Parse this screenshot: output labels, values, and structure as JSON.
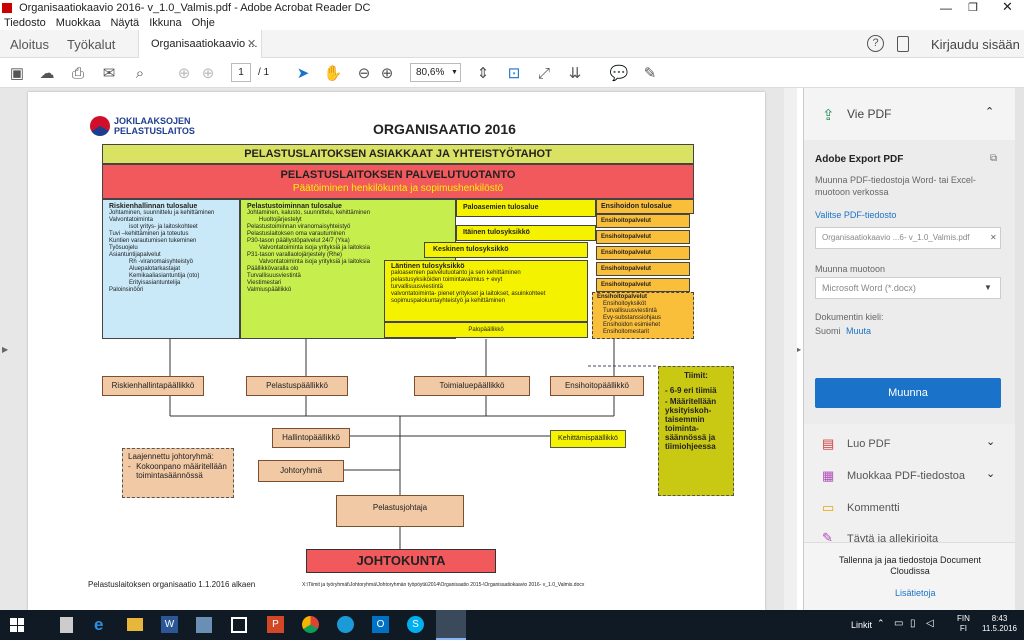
{
  "window": {
    "title": "Organisaatiokaavio 2016- v_1.0_Valmis.pdf - Adobe Acrobat Reader DC"
  },
  "menu": [
    "Tiedosto",
    "Muokkaa",
    "Näytä",
    "Ikkuna",
    "Ohje"
  ],
  "tabs": {
    "home": "Aloitus",
    "tools": "Työkalut",
    "doc": "Organisaatiokaavio ...",
    "signin": "Kirjaudu sisään"
  },
  "toolbar": {
    "page_current": "1",
    "page_total": "/ 1",
    "zoom": "80,6%"
  },
  "doc": {
    "logo_line1": "JOKILAAKSOJEN",
    "logo_line2": "PELASTUSLAITOS",
    "title": "ORGANISAATIO 2016",
    "customers": "PELASTUSLAITOKSEN ASIAKKAAT JA YHTEISTYÖTAHOT",
    "production": "PELASTUSLAITOKSEN PALVELUTUOTANTO",
    "production_sub": "Päätöiminen henkilökunta ja sopimushenkilöstö",
    "risk_title": "Riskienhallinnan tulosalue",
    "risk_items": [
      "Johtaminen, suunnittelu ja kehittäminen",
      "Valvontatoiminta",
      "isot yritys- ja laitoskohteet",
      "Tuvi –kehittäminen ja toteutus",
      "Kuntien varautumisen tukeminen",
      "Työsuojelu",
      "Asiantuntijapalvelut",
      "Rh -viranomaisyhteistyö",
      "Aluepalotarkastajat",
      "Kemikaaliasiantuntija (oto)",
      "Erityisasiantuntelija",
      "Paloinsinööri"
    ],
    "rescue_title": "Pelastustoiminnan tulosalue",
    "rescue_items": [
      "Johtaminen, kalusto, suunnittelu, kehittäminen",
      "Huoltojärjestelyt",
      "Pelastustoiminnan viranomaisyhteistyö",
      "Pelastuslaitoksen oma varautuminen",
      "P30-tason päällystöpalvelut 24/7 (Yka)",
      "Valvontatoiminta isoja yrityksiä ja laitoksia",
      "P31-tason varallaolojärjestely (Rhe)",
      "Valvontatoiminta isoja yrityksiä ja laitoksia",
      "Päällikkövaralla olo",
      "Turvallisuusviestintä",
      "Viestimestari",
      "Valmiuspäällikkö"
    ],
    "fire_title": "Paloasemien tulosalue",
    "east": "Itäinen tulosyksikkö",
    "central": "Keskinen tulosyksikkö",
    "west_title": "Läntinen tulosyksikkö",
    "west_items": [
      "paloasemien palvelutuotanto ja sen kehittäminen",
      "pelastusyksiköiden toimintavalmius + evyt",
      "turvallisuusviestintä",
      "valvontatoiminta- pienet yritykset ja laitokset, asuinkohteet",
      "sopimuspalokuntayhteistyö ja kehittäminen"
    ],
    "fire_chief": "Palopäällikkö",
    "first_title": "Ensihoidon tulosalue",
    "first_units": [
      "Ensihoitopalvelut",
      "Ensihoitopalvelut",
      "Ensihoitopalvelut",
      "Ensihoitopalvelut",
      "Ensihoitopalvelut"
    ],
    "first_box_title": "Ensihoitopalvelut",
    "first_box_items": [
      "Ensihoitoyksiköt",
      "Turvallisuusviestintä",
      "Evy-substanssiohjaus",
      "Ensihoidon esimiehet",
      "Ensihoitomestarit"
    ],
    "chief_risk": "Riskienhallintapäällikkö",
    "chief_rescue": "Pelastuspäällikkö",
    "chief_area": "Toimialuepäällikkö",
    "chief_first": "Ensihoitopäällikkö",
    "admin_chief": "Hallintopäällikkö",
    "dev_chief": "Kehittämispäällikkö",
    "teams_title": "Tiimit:",
    "teams_items": [
      "6-9 eri tiimiä",
      "Määritellään yksityiskoh-taisemmin toiminta-säännössä ja tiimiohjeessa"
    ],
    "ext_group": "Laajennettu johtoryhmä:",
    "ext_group_item": "Kokoonpano määritellään toimintasäännössä",
    "mgmt_group": "Johtoryhmä",
    "rescue_director": "Pelastusjohtaja",
    "board": "JOHTOKUNTA",
    "footer_left": "Pelastuslaitoksen organisaatio 1.1.2016 alkaen",
    "footer_right": "X:\\Tiimit ja työryhmät\\Johtoryhmä\\Johtoryhmän työpöytä\\2014\\Organisaatio 2015-\\Organisaatiokaavio 2016- v_1.0_Valmis.docx"
  },
  "pane": {
    "export": "Vie PDF",
    "export_title": "Adobe Export PDF",
    "export_desc": "Muunna PDF-tiedostoja Word- tai Excel-muotoon verkossa",
    "select_file": "Valitse PDF-tiedosto",
    "file_value": "Organisaatiokaavio ...6- v_1.0_Valmis.pdf",
    "convert_to": "Muunna muotoon",
    "format": "Microsoft Word (*.docx)",
    "lang_label": "Dokumentin kieli:",
    "lang": "Suomi",
    "lang_change": "Muuta",
    "convert_btn": "Muunna",
    "create": "Luo PDF",
    "edit": "Muokkaa PDF-tiedostoa",
    "comment": "Kommentti",
    "fill": "Täytä ja allekirjoita",
    "store": "Tallenna ja jaa tiedostoja Document Cloudissa",
    "more": "Lisätietoja"
  },
  "taskbar": {
    "links": "Linkit",
    "lang1": "FIN",
    "lang2": "FI",
    "time": "8:43",
    "date": "11.5.2016"
  },
  "colors": {
    "accent": "#1a73c8",
    "red": "#f2595d",
    "yellow": "#f5f200",
    "green": "#c6ef4d",
    "lightblue": "#c9e8f8"
  }
}
